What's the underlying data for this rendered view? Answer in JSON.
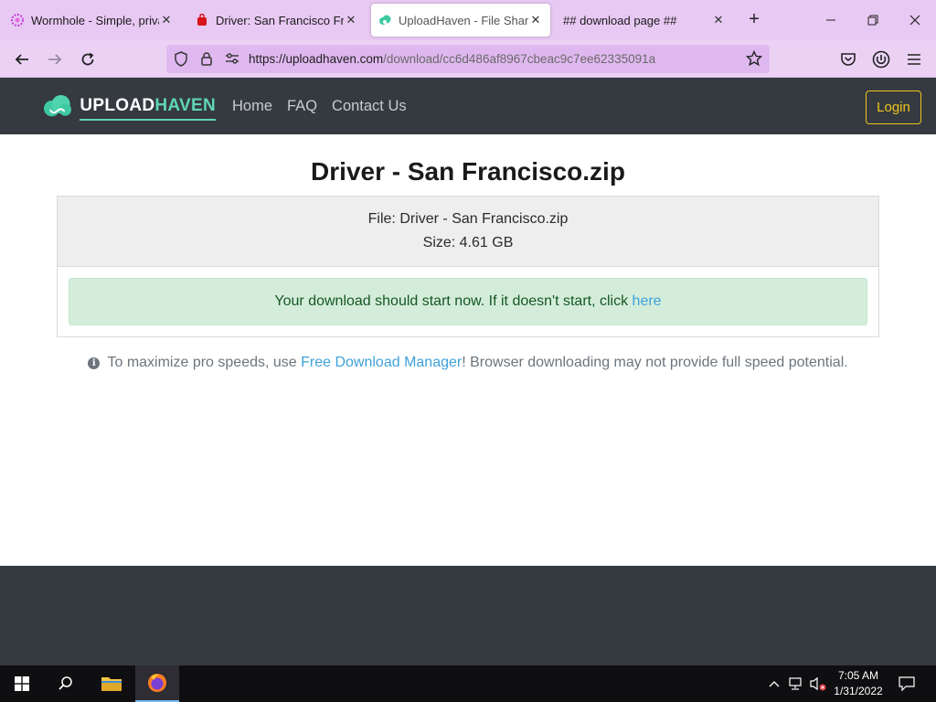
{
  "browser": {
    "tabs": [
      {
        "title": "Wormhole - Simple, private",
        "icon": "wormhole-icon",
        "active": false
      },
      {
        "title": "Driver: San Francisco Free D",
        "icon": "download-site-icon",
        "active": false
      },
      {
        "title": "UploadHaven - File Sharing",
        "icon": "uploadhaven-icon",
        "active": true
      },
      {
        "title": "## download page ##",
        "icon": "",
        "active": false
      }
    ],
    "url_host": "https://uploadhaven.com",
    "url_path": "/download/cc6d486af8967cbeac9c7ee62335091a"
  },
  "site": {
    "logo_word1": "UPLOAD",
    "logo_word2": "HAVEN",
    "nav": [
      "Home",
      "FAQ",
      "Contact Us"
    ],
    "login_label": "Login",
    "colors": {
      "header": "#343a40",
      "accent": "#5fd6b5",
      "login": "#f0c419",
      "link": "#3ea1d9"
    }
  },
  "download": {
    "title": "Driver - San Francisco.zip",
    "file_line": "File: Driver - San Francisco.zip",
    "size_line": "Size: 4.61 GB",
    "alert_text": "Your download should start now. If it doesn't start, click ",
    "alert_link": "here",
    "note_pre": "To maximize pro speeds, use ",
    "note_link": "Free Download Manager",
    "note_post": "! Browser downloading may not provide full speed potential."
  },
  "taskbar": {
    "time": "7:05 AM",
    "date": "1/31/2022"
  }
}
